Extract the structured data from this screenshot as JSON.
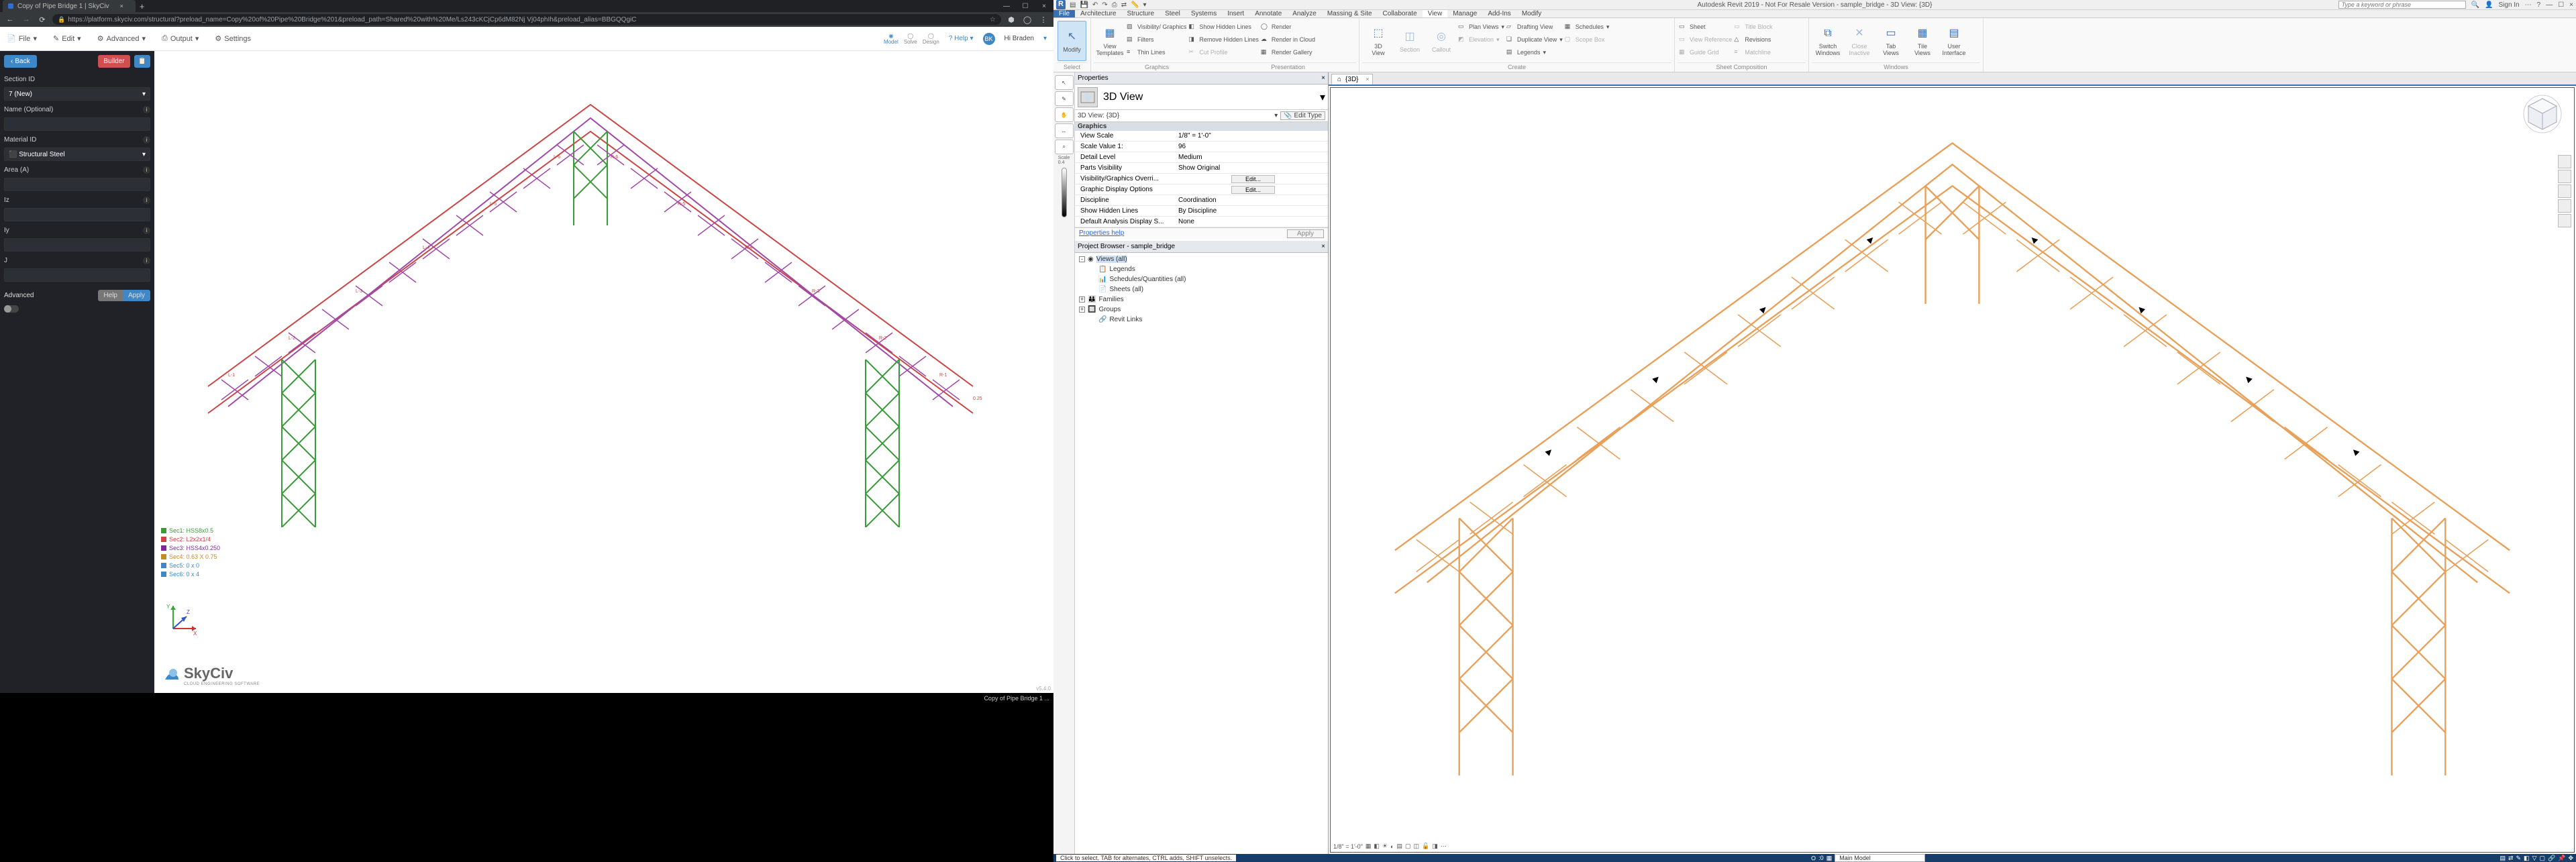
{
  "browser": {
    "tab_title": "Copy of Pipe Bridge 1 | SkyCiv",
    "url": "https://platform.skyciv.com/structural?preload_name=Copy%20of%20Pipe%20Bridge%201&preload_path=Shared%20with%20Me/Ls243cKCjCp6dM82Nj Vj04phIh&preload_alias=BBGQQgiC",
    "nav": {
      "back": "←",
      "fwd": "→",
      "reload": "⟳"
    }
  },
  "skyciv": {
    "menus": {
      "file": "File",
      "edit": "Edit",
      "advanced": "Advanced",
      "output": "Output",
      "settings": "Settings"
    },
    "modes": {
      "model": "Model",
      "solve": "Solve",
      "design": "Design"
    },
    "help": "Help",
    "user": "Hi Braden",
    "avatar": "BK",
    "sidebar": {
      "back": "Back",
      "builder": "Builder",
      "fields": {
        "section_id": "Section ID",
        "section_value": "7 (New)",
        "name": "Name (Optional)",
        "material_id": "Material ID",
        "material_value": "Structural Steel",
        "area": "Area (A)",
        "iz": "Iz",
        "iy": "Iy",
        "j": "J"
      },
      "advanced": "Advanced",
      "helpbtn": "Help",
      "apply": "Apply"
    },
    "legend": [
      {
        "color": "#3a9b3a",
        "label": "Sec1: HSS8x0.5"
      },
      {
        "color": "#c44",
        "label": "Sec2: L2x2x1/4"
      },
      {
        "color": "#7e2a9b",
        "label": "Sec3: HSS4x0.250"
      },
      {
        "color": "#c48a2a",
        "label": "Sec4: 0.63 X 0.75"
      },
      {
        "color": "#3e88c7",
        "label": "Sec5: 0 x 0"
      },
      {
        "color": "#3e88c7",
        "label": "Sec6: 0 x 4"
      }
    ],
    "logo": "SkyCiv",
    "logo_tag": "CLOUD ENGINEERING SOFTWARE",
    "version": "v5.4.0"
  },
  "taskbar": {
    "open": "Copy of Pipe Bridge 1 ..."
  },
  "revit": {
    "title": "Autodesk Revit 2019 - Not For Resale Version - sample_bridge - 3D View: {3D}",
    "search_ph": "Type a keyword or phrase",
    "signin": "Sign In",
    "menus": [
      "File",
      "Architecture",
      "Structure",
      "Steel",
      "Systems",
      "Insert",
      "Annotate",
      "Analyze",
      "Massing & Site",
      "Collaborate",
      "View",
      "Manage",
      "Add-Ins",
      "Modify"
    ],
    "ribbon": {
      "select": "Select",
      "modify": "Modify",
      "view_templates": "View\nTemplates",
      "visibility_graphics": "Visibility/ Graphics",
      "filters": "Filters",
      "thin_lines": "Thin  Lines",
      "show_hidden": "Show  Hidden Lines",
      "remove_hidden": "Remove  Hidden Lines",
      "cut_profile": "Cut  Profile",
      "render": "Render",
      "render_cloud": "Render  in Cloud",
      "render_gallery": "Render  Gallery",
      "threeD": "3D\nView",
      "section": "Section",
      "callout": "Callout",
      "plan_views": "Plan  Views",
      "elevation": "Elevation",
      "drafting_view": "Drafting  View",
      "duplicate": "Duplicate  View",
      "legends": "Legends",
      "scope_box": "Scope  Box",
      "schedules": "Schedules",
      "sheet": "Sheet",
      "view_ref": "View  Reference",
      "guide_grid": "Guide  Grid",
      "title_block": "Title  Block",
      "revisions": "Revisions",
      "matchline": "Matchline",
      "switch_windows": "Switch\nWindows",
      "close_inactive": "Close\nInactive",
      "tab_views": "Tab\nViews",
      "tile_views": "Tile\nViews",
      "ui": "User\nInterface",
      "groups": {
        "graphics": "Graphics",
        "presentation": "Presentation",
        "create": "Create",
        "sheetcomp": "Sheet Composition",
        "windows": "Windows"
      }
    },
    "properties": {
      "panel_title": "Properties",
      "type": "3D View",
      "instance": "3D View: {3D}",
      "edit_type": "Edit Type",
      "group": "Graphics",
      "rows": [
        {
          "k": "View Scale",
          "v": "1/8\" = 1'-0\""
        },
        {
          "k": "Scale Value    1:",
          "v": "96"
        },
        {
          "k": "Detail Level",
          "v": "Medium"
        },
        {
          "k": "Parts Visibility",
          "v": "Show Original"
        },
        {
          "k": "Visibility/Graphics Overri...",
          "v": "Edit...",
          "btn": true
        },
        {
          "k": "Graphic Display Options",
          "v": "Edit...",
          "btn": true
        },
        {
          "k": "Discipline",
          "v": "Coordination"
        },
        {
          "k": "Show Hidden Lines",
          "v": "By Discipline"
        },
        {
          "k": "Default Analysis Display S...",
          "v": "None"
        }
      ],
      "help": "Properties help",
      "apply": "Apply"
    },
    "browser": {
      "title": "Project Browser - sample_bridge",
      "items": [
        {
          "exp": "-",
          "icon": "◉",
          "label": "Views (all)",
          "indent": 0,
          "active": true
        },
        {
          "exp": "",
          "icon": "📋",
          "label": "Legends",
          "indent": 1
        },
        {
          "exp": "",
          "icon": "📊",
          "label": "Schedules/Quantities (all)",
          "indent": 1
        },
        {
          "exp": "",
          "icon": "📄",
          "label": "Sheets (all)",
          "indent": 1
        },
        {
          "exp": "+",
          "icon": "👪",
          "label": "Families",
          "indent": 0
        },
        {
          "exp": "+",
          "icon": "🔲",
          "label": "Groups",
          "indent": 0
        },
        {
          "exp": "",
          "icon": "🔗",
          "label": "Revit Links",
          "indent": 1
        }
      ]
    },
    "view_tab": "{3D}",
    "view_controls": "1/8\" = 1'-0\"",
    "statusbar": {
      "hint": "Click to select, TAB for alternates, CTRL adds, SHIFT unselects.",
      "model": "Main Model",
      "count": ":0"
    }
  }
}
